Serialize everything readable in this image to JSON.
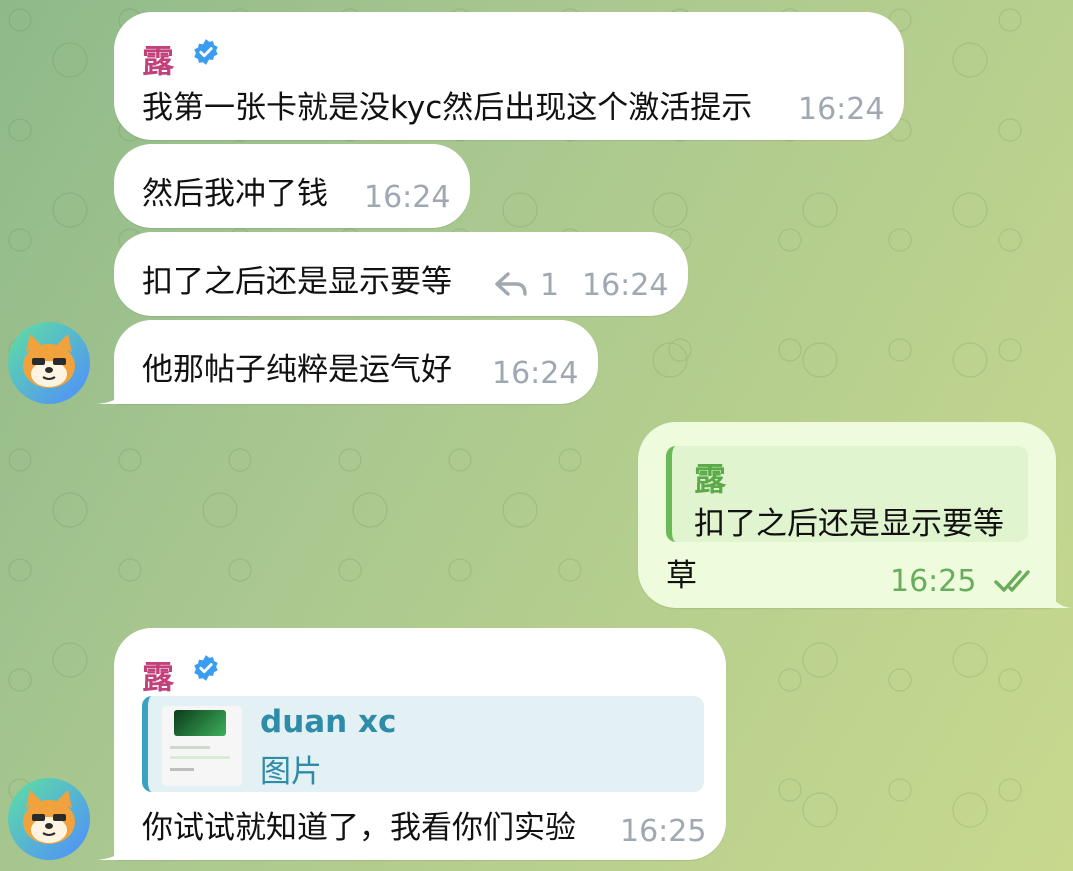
{
  "messages": [
    {
      "sender": "露",
      "text": "我第一张卡就是没kyc然后出现这个激活提示",
      "time": "16:24"
    },
    {
      "text": "然后我冲了钱",
      "time": "16:24"
    },
    {
      "text": "扣了之后还是显示要等",
      "time": "16:24",
      "reply_count": "1"
    },
    {
      "text": "他那帖子纯粹是运气好",
      "time": "16:24"
    }
  ],
  "outgoing": {
    "quote_sender": "露",
    "quote_text": "扣了之后还是显示要等",
    "text": "草",
    "time": "16:25"
  },
  "media_message": {
    "sender": "露",
    "quote_name": "duan xc",
    "quote_type": "图片",
    "text": "你试试就知道了，我看你们实验",
    "time": "16:25"
  },
  "colors": {
    "sender": "#c2417a",
    "outgoing_accent": "#6aac5d",
    "media_accent": "#2e8ca8",
    "verified": "#3a9df0"
  },
  "icons": [
    "verified-icon",
    "reply-icon",
    "double-check-icon",
    "avatar-shiba-icon"
  ]
}
